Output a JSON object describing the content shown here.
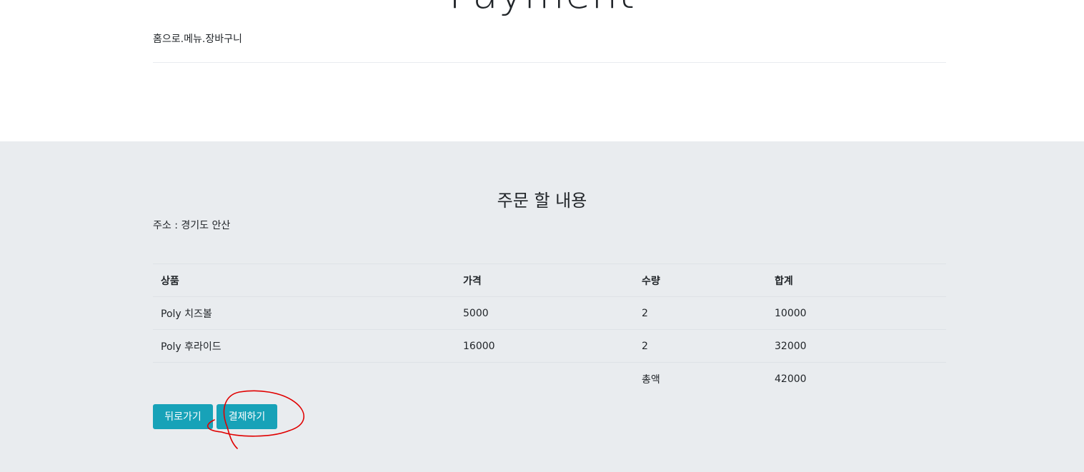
{
  "header": {
    "title": "Payment",
    "breadcrumb": {
      "home": "홈으로",
      "menu": "메뉴",
      "cart": "장바구니",
      "separator": "."
    }
  },
  "order": {
    "heading": "주문 할 내용",
    "address": "주소 : 경기도 안산",
    "columns": [
      "상품",
      "가격",
      "수량",
      "합계"
    ],
    "rows": [
      {
        "product": "Poly 치즈볼",
        "price": "5000",
        "qty": "2",
        "subtotal": "10000"
      },
      {
        "product": "Poly 후라이드",
        "price": "16000",
        "qty": "2",
        "subtotal": "32000"
      }
    ],
    "total_label": "총액",
    "total_value": "42000"
  },
  "buttons": {
    "back_label": "뒤로가기",
    "pay_label": "결제하기"
  },
  "colors": {
    "accent": "#17a2b8",
    "section_bg": "#e9ecef",
    "annotation": "#e00000"
  }
}
